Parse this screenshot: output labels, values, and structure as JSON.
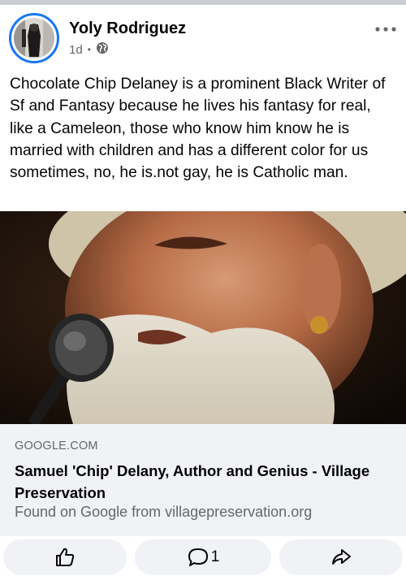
{
  "post": {
    "author": "Yoly Rodriguez",
    "time": "1d",
    "separator": "•",
    "text": "Chocolate Chip Delaney is a prominent Black Writer of Sf and Fantasy because he lives his fantasy for real, like a Cameleon, those who know him know he is married with children and has a different color for us sometimes, no, he is.not gay, he is Catholic man."
  },
  "link": {
    "domain": "GOOGLE.COM",
    "title": "Samuel 'Chip' Delany, Author and Genius - Village Preservation",
    "description": "Found on Google from villagepreservation.org"
  },
  "actions": {
    "comment_count": "1"
  },
  "icons": {
    "privacy": "globe-icon",
    "more": "more-dots-icon",
    "like": "thumbs-up-icon",
    "comment": "comment-icon",
    "share": "share-icon"
  },
  "colors": {
    "accent": "#1877f2",
    "text_primary": "#050505",
    "text_secondary": "#65676b",
    "surface": "#f0f2f5"
  }
}
